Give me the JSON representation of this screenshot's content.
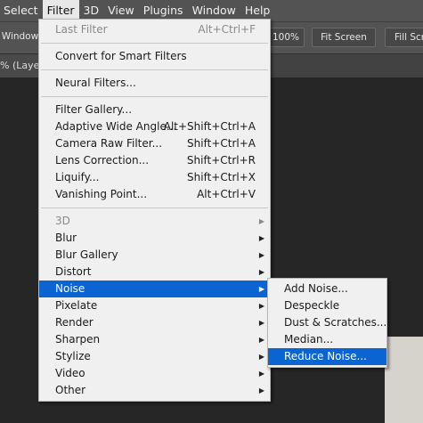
{
  "menubar": {
    "items": [
      "Select",
      "Filter",
      "3D",
      "View",
      "Plugins",
      "Window",
      "Help"
    ],
    "active": "Filter"
  },
  "options_bar": {
    "scrub_windows_label": "e Windows",
    "zoom_label": "100%",
    "fit_screen_label": "Fit Screen",
    "fill_screen_label": "Fill Scre"
  },
  "doc_tab": {
    "label": "% (Layer"
  },
  "filter_menu": {
    "groups": [
      [
        {
          "label": "Last Filter",
          "shortcut": "Alt+Ctrl+F",
          "disabled": true
        }
      ],
      [
        {
          "label": "Convert for Smart Filters"
        }
      ],
      [
        {
          "label": "Neural Filters..."
        }
      ],
      [
        {
          "label": "Filter Gallery..."
        },
        {
          "label": "Adaptive Wide Angle...",
          "shortcut": "Alt+Shift+Ctrl+A"
        },
        {
          "label": "Camera Raw Filter...",
          "shortcut": "Shift+Ctrl+A"
        },
        {
          "label": "Lens Correction...",
          "shortcut": "Shift+Ctrl+R"
        },
        {
          "label": "Liquify...",
          "shortcut": "Shift+Ctrl+X"
        },
        {
          "label": "Vanishing Point...",
          "shortcut": "Alt+Ctrl+V"
        }
      ],
      [
        {
          "label": "3D",
          "submenu": true,
          "disabled": true
        },
        {
          "label": "Blur",
          "submenu": true
        },
        {
          "label": "Blur Gallery",
          "submenu": true
        },
        {
          "label": "Distort",
          "submenu": true
        },
        {
          "label": "Noise",
          "submenu": true,
          "highlighted": true
        },
        {
          "label": "Pixelate",
          "submenu": true
        },
        {
          "label": "Render",
          "submenu": true
        },
        {
          "label": "Sharpen",
          "submenu": true
        },
        {
          "label": "Stylize",
          "submenu": true
        },
        {
          "label": "Video",
          "submenu": true
        },
        {
          "label": "Other",
          "submenu": true
        }
      ]
    ]
  },
  "noise_submenu": {
    "items": [
      {
        "label": "Add Noise..."
      },
      {
        "label": "Despeckle"
      },
      {
        "label": "Dust & Scratches..."
      },
      {
        "label": "Median..."
      },
      {
        "label": "Reduce Noise...",
        "highlighted": true
      }
    ]
  },
  "colors": {
    "highlight": "#0a64d2",
    "menu_bg": "#f0f0f0",
    "app_bg": "#535353",
    "canvas_bg": "#262626"
  }
}
